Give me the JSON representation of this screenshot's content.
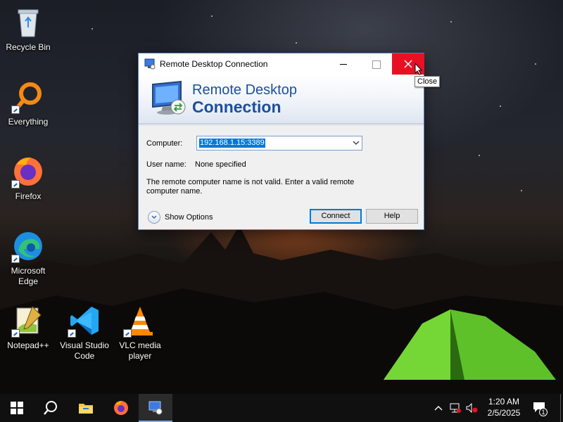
{
  "desktop": {
    "icons": [
      {
        "label": "Recycle Bin",
        "icon": "recycle-bin-icon"
      },
      {
        "label": "Everything",
        "icon": "everything-search-icon"
      },
      {
        "label": "Firefox",
        "icon": "firefox-icon"
      },
      {
        "label": "Microsoft Edge",
        "icon": "edge-icon"
      },
      {
        "label": "Notepad++",
        "icon": "notepad-plus-plus-icon"
      },
      {
        "label": "Visual Studio Code",
        "icon": "vscode-icon"
      },
      {
        "label": "VLC media player",
        "icon": "vlc-icon"
      }
    ]
  },
  "window": {
    "title": "Remote Desktop Connection",
    "banner_line1": "Remote Desktop",
    "banner_line2": "Connection",
    "computer_label": "Computer:",
    "computer_value": "192.168.1.15:3389",
    "username_label": "User name:",
    "username_value": "None specified",
    "error_message": "The remote computer name is not valid. Enter a valid remote computer name.",
    "show_options_label": "Show Options",
    "connect_label": "Connect",
    "help_label": "Help",
    "close_tooltip": "Close"
  },
  "taskbar": {
    "items": [
      "start-icon",
      "search-icon",
      "file-explorer-icon",
      "firefox-icon",
      "remote-desktop-icon"
    ],
    "time": "1:20 AM",
    "date": "2/5/2025",
    "notification_count": "1"
  },
  "colors": {
    "accent": "#0078d7",
    "close_red": "#e81123",
    "banner_text": "#1c4f9b"
  }
}
